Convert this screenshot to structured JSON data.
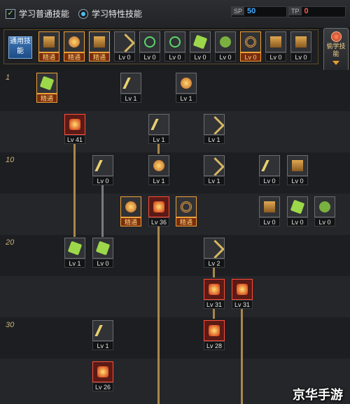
{
  "tabs": {
    "normal": "学习普通技能",
    "special": "学习特性技能"
  },
  "sp": {
    "label_a": "SP",
    "value_a": "50",
    "label_b": "TP",
    "value_b": "0"
  },
  "common": {
    "label": "通用技能",
    "elite": "精通",
    "lv0": "Lv 0"
  },
  "learn_button": "偷学技能",
  "levels": [
    "1",
    "10",
    "20",
    "30"
  ],
  "tags": {
    "elite": "精通",
    "lv0": "Lv 0",
    "lv1": "Lv 1",
    "lv2": "Lv 2",
    "lv26": "Lv 26",
    "lv28": "Lv 28",
    "lv31": "Lv 31",
    "lv36": "Lv 36",
    "lv41": "Lv 41"
  },
  "watermark": "京华手游"
}
